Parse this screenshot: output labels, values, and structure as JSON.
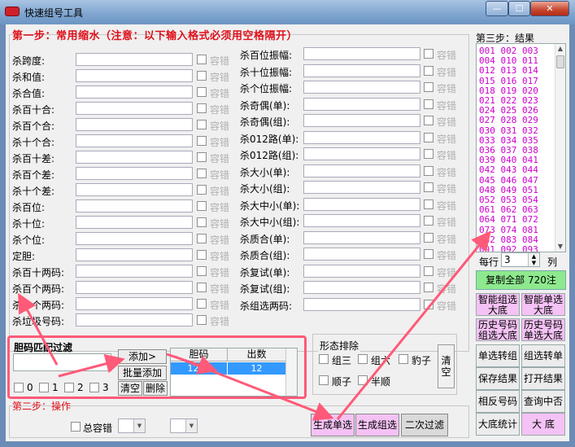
{
  "window": {
    "title": "快速组号工具",
    "close_label": "✕",
    "max_label": "☐",
    "min_label": "—"
  },
  "step1": {
    "title": "第一步：常用缩水（注意：以下输入格式必须用空格隔开）",
    "tolerance_label": "容错"
  },
  "left_filters": [
    "杀跨度:",
    "杀和值:",
    "杀合值:",
    "杀百十合:",
    "杀百个合:",
    "杀十个合:",
    "杀百十差:",
    "杀百个差:",
    "杀十个差:",
    "杀百位:",
    "杀十位:",
    "杀个位:",
    "定胆:",
    "杀百十两码:",
    "杀百个两码:",
    "杀十个两码:",
    "杀垃圾号码:"
  ],
  "right_filters": [
    "杀百位振幅:",
    "杀十位振幅:",
    "杀个位振幅:",
    "杀奇偶(单):",
    "杀奇偶(组):",
    "杀012路(单):",
    "杀012路(组):",
    "杀大小(单):",
    "杀大小(组):",
    "杀大中小(单):",
    "杀大中小(组):",
    "杀质合(单):",
    "杀质合(组):",
    "杀复试(单):",
    "杀复试(组):",
    "杀组选两码:"
  ],
  "step3": {
    "title": "第三步：结果",
    "results": [
      "001 002 003",
      "004 010 011",
      "012 013 014",
      "015 016 017",
      "018 019 020",
      "021 022 023",
      "024 025 026",
      "027 028 029",
      "030 031 032",
      "033 034 035",
      "036 037 038",
      "039 040 041",
      "042 043 044",
      "045 046 047",
      "048 049 051",
      "052 053 054",
      "061 062 063",
      "064 071 072",
      "073 074 081",
      "082 083 084",
      "091 092 093"
    ],
    "per_row_label": "每行",
    "per_row_value": "3",
    "per_row_unit": "列",
    "copy_all_label": "复制全部  720注"
  },
  "right_buttons": [
    [
      "智能组选大底",
      "智能单选大底"
    ],
    [
      "历史号码组选大底",
      "历史号码单选大底"
    ],
    [
      "单选转组",
      "组选转单"
    ],
    [
      "保存结果",
      "打开结果"
    ],
    [
      "相反号码",
      "查询中否"
    ],
    [
      "大底统计",
      "大  底"
    ]
  ],
  "dan_filter": {
    "title": "胆码匹配过滤",
    "add_label": "添加>",
    "batch_add_label": "批量添加",
    "clear_label": "清空",
    "delete_label": "删除",
    "options": [
      "0",
      "1",
      "2",
      "3"
    ],
    "table": {
      "headers": [
        "胆码",
        "出数"
      ],
      "rows": [
        [
          "1234",
          "12"
        ]
      ]
    }
  },
  "shape_exclude": {
    "title": "形态排除",
    "options": [
      "组三",
      "组六",
      "豹子",
      "顺子",
      "半顺"
    ],
    "clear_label": "清空"
  },
  "step2": {
    "title": "第二步：操作",
    "total_tolerance_label": "总容错",
    "range_separator": "-"
  },
  "actions": {
    "single_label": "生成单选",
    "group_label": "生成组选",
    "second_filter_label": "二次过滤"
  }
}
